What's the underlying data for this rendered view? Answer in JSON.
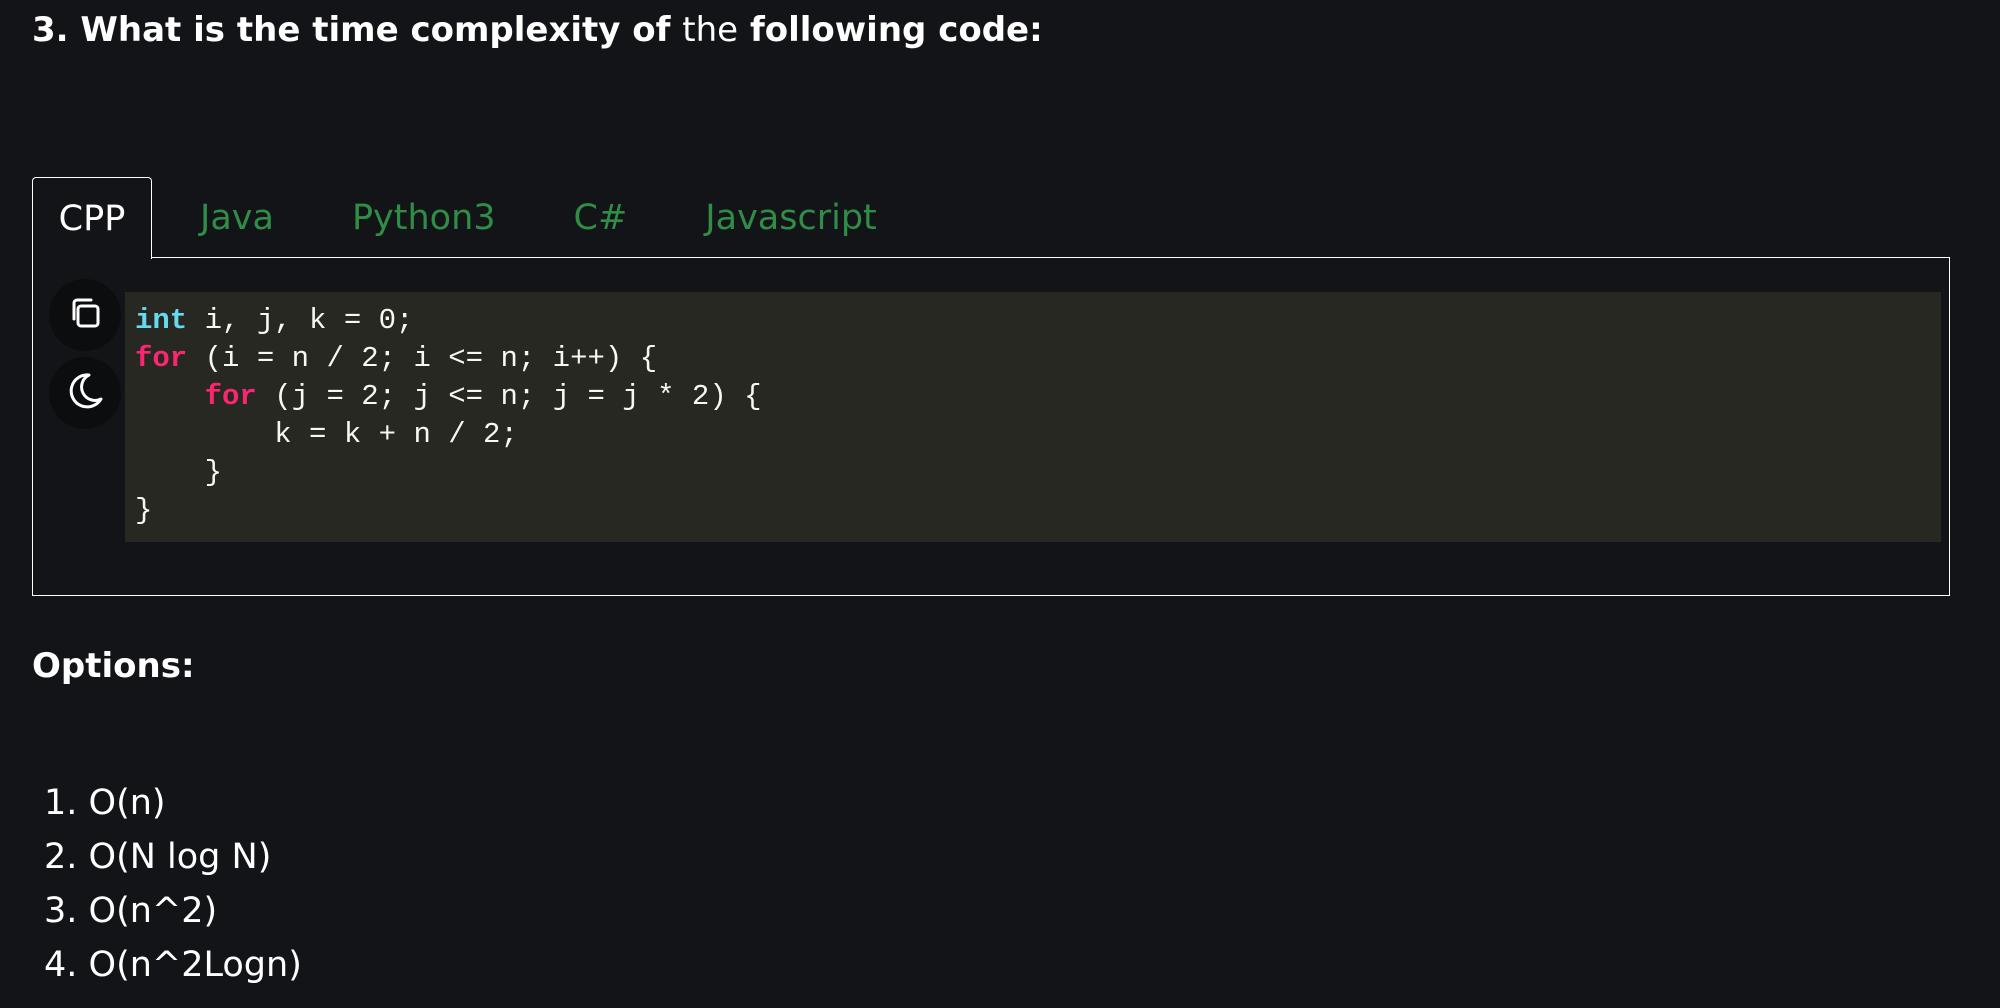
{
  "question": {
    "part1": "3. What is the time complexity of ",
    "part2": "the",
    "part3": " following code:"
  },
  "tabs": [
    {
      "label": "CPP",
      "active": true
    },
    {
      "label": "Java",
      "active": false
    },
    {
      "label": "Python3",
      "active": false
    },
    {
      "label": "C#",
      "active": false
    },
    {
      "label": "Javascript",
      "active": false
    }
  ],
  "icons": {
    "copy": "copy-icon",
    "theme": "moon-icon"
  },
  "code": {
    "line1": {
      "kw": "int",
      "rest": " i, j, k = 0;"
    },
    "line2": {
      "kw": "for",
      "rest": " (i = n / 2; i <= n; i++) {"
    },
    "line3": {
      "indent": "    ",
      "kw": "for",
      "rest": " (j = 2; j <= n; j = j * 2) {"
    },
    "line4": {
      "text": "        k = k + n / 2;"
    },
    "line5": {
      "text": "    }"
    },
    "line6": {
      "text": "}"
    }
  },
  "options": {
    "heading": "Options:",
    "items": [
      "1. O(n)",
      "2. O(N log N)",
      "3. O(n^2)",
      "4. O(n^2Logn)"
    ]
  },
  "colors": {
    "background": "#131417",
    "code_background": "#272822",
    "tab_inactive": "#2f8d46",
    "keyword_type": "#66d9ef",
    "keyword_control": "#f92672"
  }
}
